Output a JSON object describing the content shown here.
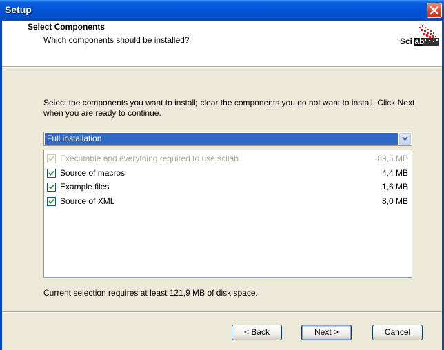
{
  "window": {
    "title": "Setup"
  },
  "header": {
    "title": "Select Components",
    "subtitle": "Which components should be installed?",
    "logo_text": "Scilab"
  },
  "instructions": "Select the components you want to install; clear the components you do not want to install. Click Next when you are ready to continue.",
  "installation_type": {
    "selected": "Full installation"
  },
  "components": [
    {
      "label": "Executable and everything required to use scilab",
      "size": "89,5 MB",
      "checked": true,
      "disabled": true
    },
    {
      "label": "Source of macros",
      "size": "4,4 MB",
      "checked": true,
      "disabled": false
    },
    {
      "label": "Example files",
      "size": "1,6 MB",
      "checked": true,
      "disabled": false
    },
    {
      "label": "Source of XML",
      "size": "8,0 MB",
      "checked": true,
      "disabled": false
    }
  ],
  "disk_space": "Current selection requires at least 121,9 MB of disk space.",
  "buttons": {
    "back": "< Back",
    "next": "Next >",
    "cancel": "Cancel"
  },
  "colors": {
    "titlebar": "#0556d8",
    "selection": "#316ac5",
    "check": "#21a121",
    "background": "#ece9d8"
  },
  "icons": {
    "close": "close-icon",
    "dropdown": "chevron-down-icon",
    "checkbox": "checkmark-icon"
  }
}
